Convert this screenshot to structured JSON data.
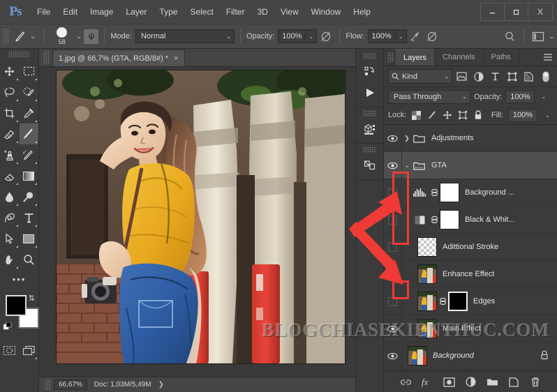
{
  "app": {
    "name": "Ps",
    "logo_color": "#6f9fd8"
  },
  "menubar": {
    "items": [
      "File",
      "Edit",
      "Image",
      "Layer",
      "Type",
      "Select",
      "Filter",
      "3D",
      "View",
      "Window",
      "Help"
    ],
    "window_controls": {
      "minimize": "—",
      "maximize": "□",
      "close": "X"
    }
  },
  "options_bar": {
    "tool_icon": "brush-icon",
    "brush_size": "58",
    "mode_label": "Mode:",
    "mode_value": "Normal",
    "opacity_label": "Opacity:",
    "opacity_value": "100%",
    "flow_label": "Flow:",
    "flow_value": "100%",
    "airbrush_icon": "airbrush-icon",
    "smoothing_icon": "smoothing-icon",
    "symmetry_icon": "symmetry-icon",
    "search_icon": "search-icon",
    "workspace_icon": "workspace-icon"
  },
  "toolbar": {
    "tools": [
      {
        "name": "move-tool",
        "label": "Move"
      },
      {
        "name": "marquee-tool",
        "label": "Rectangular Marquee"
      },
      {
        "name": "lasso-tool",
        "label": "Lasso"
      },
      {
        "name": "quick-selection-tool",
        "label": "Quick Selection"
      },
      {
        "name": "crop-tool",
        "label": "Crop"
      },
      {
        "name": "eyedropper-tool",
        "label": "Eyedropper"
      },
      {
        "name": "healing-brush-tool",
        "label": "Spot Healing Brush"
      },
      {
        "name": "brush-tool",
        "label": "Brush",
        "active": true
      },
      {
        "name": "clone-stamp-tool",
        "label": "Clone Stamp"
      },
      {
        "name": "history-brush-tool",
        "label": "History Brush"
      },
      {
        "name": "eraser-tool",
        "label": "Eraser"
      },
      {
        "name": "gradient-tool",
        "label": "Gradient"
      },
      {
        "name": "blur-tool",
        "label": "Blur"
      },
      {
        "name": "dodge-tool",
        "label": "Dodge"
      },
      {
        "name": "pen-tool",
        "label": "Pen"
      },
      {
        "name": "type-tool",
        "label": "Horizontal Type"
      },
      {
        "name": "path-selection-tool",
        "label": "Path Selection"
      },
      {
        "name": "shape-tool",
        "label": "Rectangle"
      },
      {
        "name": "hand-tool",
        "label": "Hand"
      },
      {
        "name": "zoom-tool",
        "label": "Zoom"
      }
    ],
    "more_tools": "…",
    "foreground_color": "#000000",
    "background_color": "#ffffff",
    "quick_mask_icon": "quick-mask-icon",
    "screen_mode_icon": "screen-mode-icon"
  },
  "document": {
    "tab_title": "1.jpg @ 66,7% (GTA, RGB/8#) *",
    "close_icon": "×",
    "watermark": "BLOGCHIASEKIENTHUC.COM"
  },
  "statusbar": {
    "zoom": "66,67%",
    "doc_info": "Doc: 1,03M/5,49M",
    "expand_arrow": "❯"
  },
  "minidock": {
    "items": [
      {
        "name": "history-panel-icon"
      },
      {
        "name": "actions-play-icon"
      },
      {
        "name": "3d-panel-icon"
      },
      {
        "name": "libraries-panel-icon"
      }
    ]
  },
  "layers_panel": {
    "tabs": [
      {
        "label": "Layers",
        "active": true
      },
      {
        "label": "Channels",
        "active": false
      },
      {
        "label": "Paths",
        "active": false
      }
    ],
    "menu_icon": "panel-menu-icon",
    "filter": {
      "kind_label": "Kind",
      "icons": [
        "filter-pixel-icon",
        "filter-adjustment-icon",
        "filter-type-icon",
        "filter-shape-icon",
        "filter-smart-icon",
        "filter-toggle-icon"
      ]
    },
    "blend_mode": "Pass Through",
    "opacity_label": "Opacity:",
    "opacity_value": "100%",
    "lock_label": "Lock:",
    "lock_icons": [
      "lock-transparent-icon",
      "lock-image-icon",
      "lock-position-icon",
      "lock-artboard-icon",
      "lock-all-icon"
    ],
    "fill_label": "Fill:",
    "fill_value": "100%",
    "layers": [
      {
        "name": "Adjustments",
        "visible": true,
        "type": "group",
        "expanded": false,
        "indent": 0,
        "selected": false
      },
      {
        "name": "GTA",
        "visible": true,
        "type": "group",
        "expanded": true,
        "indent": 0,
        "selected": true
      },
      {
        "name": "Background ...",
        "visible": false,
        "type": "adjustment",
        "adj_icon": "levels-icon",
        "mask": "white",
        "linked": true,
        "indent": 1,
        "selected": false
      },
      {
        "name": "Black & Whit...",
        "visible": false,
        "type": "adjustment",
        "adj_icon": "black-white-icon",
        "mask": "white",
        "linked": true,
        "indent": 1,
        "selected": false
      },
      {
        "name": "Adittional Stroke",
        "visible": false,
        "type": "pixel",
        "thumb": "checker",
        "indent": 1,
        "selected": false
      },
      {
        "name": "Enhance Effect",
        "visible": true,
        "type": "pixel",
        "thumb": "photo",
        "indent": 1,
        "selected": false
      },
      {
        "name": "Edges",
        "visible": false,
        "type": "pixel",
        "thumb": "photo",
        "mask": "black",
        "linked": true,
        "indent": 1,
        "selected": false
      },
      {
        "name": "Main Effect",
        "visible": true,
        "type": "pixel",
        "thumb": "photo",
        "indent": 1,
        "selected": false
      },
      {
        "name": "Background",
        "visible": true,
        "type": "background",
        "thumb": "photo",
        "italic": true,
        "locked": true,
        "indent": 0,
        "selected": false
      }
    ],
    "bottom_icons": [
      {
        "name": "link-layers-icon"
      },
      {
        "name": "layer-style-fx-icon",
        "glyph": "fx"
      },
      {
        "name": "add-mask-icon"
      },
      {
        "name": "new-adjustment-icon"
      },
      {
        "name": "new-group-icon"
      },
      {
        "name": "new-layer-icon"
      },
      {
        "name": "delete-layer-icon"
      }
    ]
  },
  "annotations": {
    "color": "#ef3a35",
    "highlight_boxes": 2,
    "arrow": "two-pronged-arrow"
  }
}
